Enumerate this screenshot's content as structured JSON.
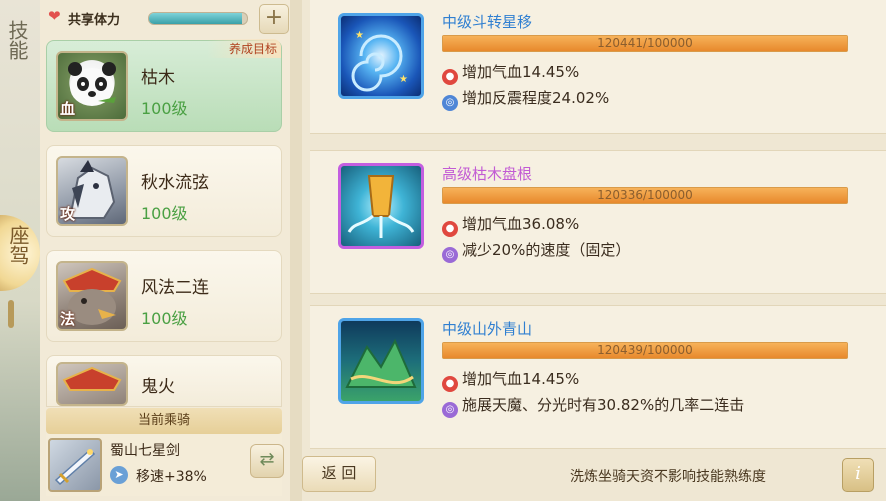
{
  "side_tabs": {
    "skill": "技能",
    "mount": "座驾"
  },
  "stamina": {
    "label": "共享体力",
    "fill_fraction": 0.95,
    "plus": "+"
  },
  "skill_cards": [
    {
      "name": "枯木",
      "level": "100级",
      "tag": "血",
      "goal": "养成目标",
      "active": true
    },
    {
      "name": "秋水流弦",
      "level": "100级",
      "tag": "攻",
      "active": false
    },
    {
      "name": "风法二连",
      "level": "100级",
      "tag": "法",
      "active": false
    },
    {
      "name": "鬼火",
      "level": "",
      "tag": "",
      "active": false
    }
  ],
  "current_mount": {
    "header": "当前乘骑",
    "name": "蜀山七星剑",
    "speed": "移速+38%"
  },
  "skills": [
    {
      "title": "中级斗转星移",
      "color": "blue",
      "progress_text": "120441/100000",
      "progress_fraction": 1.0,
      "effects": [
        {
          "icon": "red",
          "text": "增加气血14.45%"
        },
        {
          "icon": "blue",
          "text": "增加反震程度24.02%"
        }
      ]
    },
    {
      "title": "高级枯木盘根",
      "color": "purple",
      "progress_text": "120336/100000",
      "progress_fraction": 1.0,
      "effects": [
        {
          "icon": "red",
          "text": "增加气血36.08%"
        },
        {
          "icon": "purple",
          "text": "减少20%的速度（固定）"
        }
      ]
    },
    {
      "title": "中级山外青山",
      "color": "blue",
      "progress_text": "120439/100000",
      "progress_fraction": 1.0,
      "effects": [
        {
          "icon": "red",
          "text": "增加气血14.45%"
        },
        {
          "icon": "purple",
          "text": "施展天魔、分光时有30.82%的几率二连击"
        }
      ]
    }
  ],
  "back_label": "返 回",
  "footer_note": "洗炼坐骑天资不影响技能熟练度",
  "info_label": "i"
}
